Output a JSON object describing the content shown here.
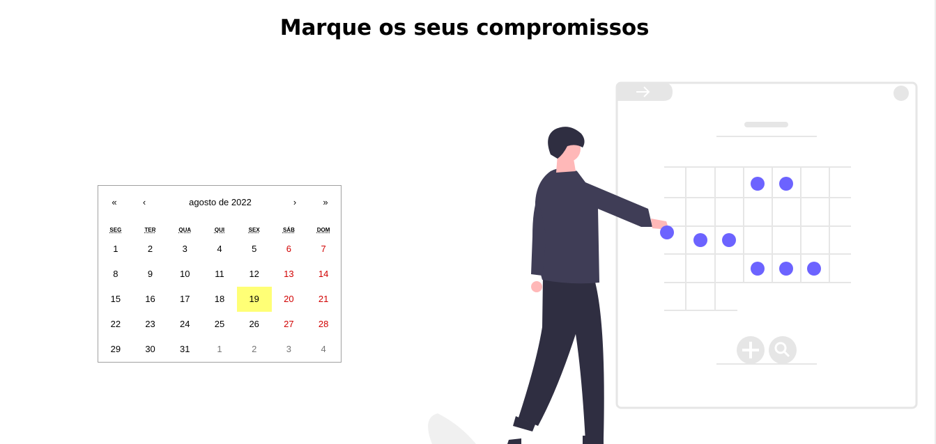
{
  "page": {
    "title": "Marque os seus compromissos"
  },
  "calendar": {
    "prev_year": "«",
    "prev_month": "‹",
    "month_label": "agosto de 2022",
    "next_month": "›",
    "next_year": "»",
    "weekdays": [
      "SEG",
      "TER",
      "QUA",
      "QUI",
      "SEX",
      "SÁB",
      "DOM"
    ],
    "weeks": [
      [
        "1",
        "2",
        "3",
        "4",
        "5",
        "6",
        "7"
      ],
      [
        "8",
        "9",
        "10",
        "11",
        "12",
        "13",
        "14"
      ],
      [
        "15",
        "16",
        "17",
        "18",
        "19",
        "20",
        "21"
      ],
      [
        "22",
        "23",
        "24",
        "25",
        "26",
        "27",
        "28"
      ],
      [
        "29",
        "30",
        "31",
        "1",
        "2",
        "3",
        "4"
      ]
    ],
    "today": "19",
    "colors": {
      "weekend": "#d10000",
      "neighbor_month": "#757575",
      "today_highlight": "#ffff76"
    }
  },
  "illustration": {
    "description_icon": "person-scheduling-calendar-illustration",
    "accent": "#6c63ff",
    "ui_icons": [
      "arrow-right-icon",
      "plus-icon",
      "search-icon"
    ]
  }
}
